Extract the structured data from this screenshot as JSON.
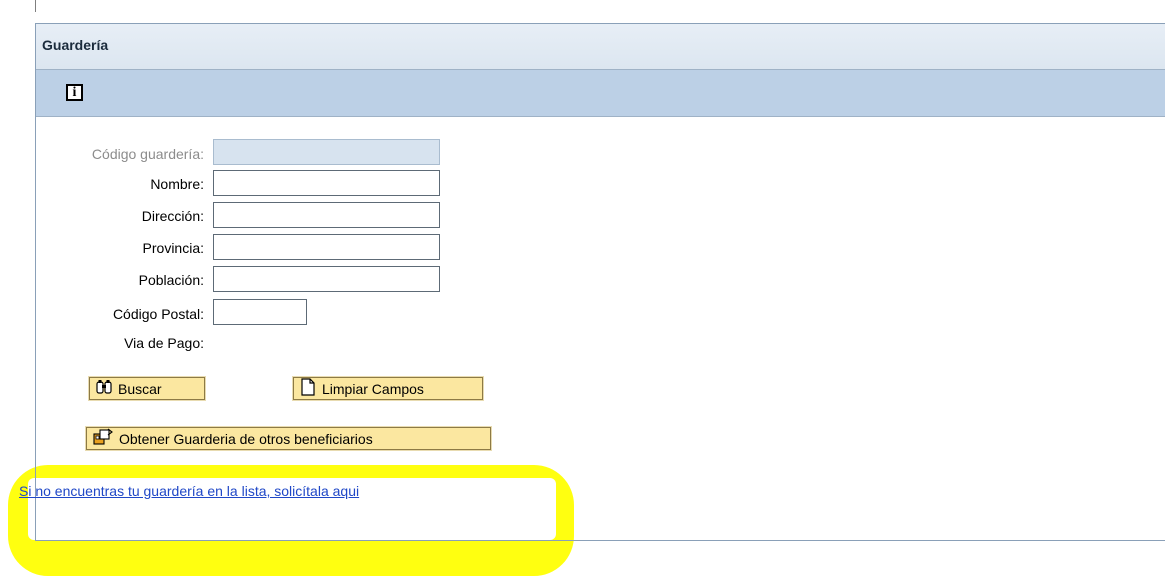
{
  "panel": {
    "title": "Guardería"
  },
  "toolbar": {
    "info_icon": "info-icon"
  },
  "form": {
    "codigo_label": "Código guardería:",
    "codigo_value": "",
    "nombre_label": "Nombre:",
    "nombre_value": "",
    "direccion_label": "Dirección:",
    "direccion_value": "",
    "provincia_label": "Provincia:",
    "provincia_value": "",
    "poblacion_label": "Población:",
    "poblacion_value": "",
    "cp_label": "Código Postal:",
    "cp_value": "",
    "via_pago_label": "Via de Pago:"
  },
  "buttons": {
    "buscar": "Buscar",
    "limpiar": "Limpiar Campos",
    "obtener": "Obtener Guarderia de otros beneficiarios"
  },
  "link": {
    "text": "Si no encuentras tu guardería en la lista, solicítala aqui"
  },
  "colors": {
    "highlight": "#ffff10",
    "button_bg": "#fbe7a0",
    "toolbar": "#bcd0e6"
  }
}
